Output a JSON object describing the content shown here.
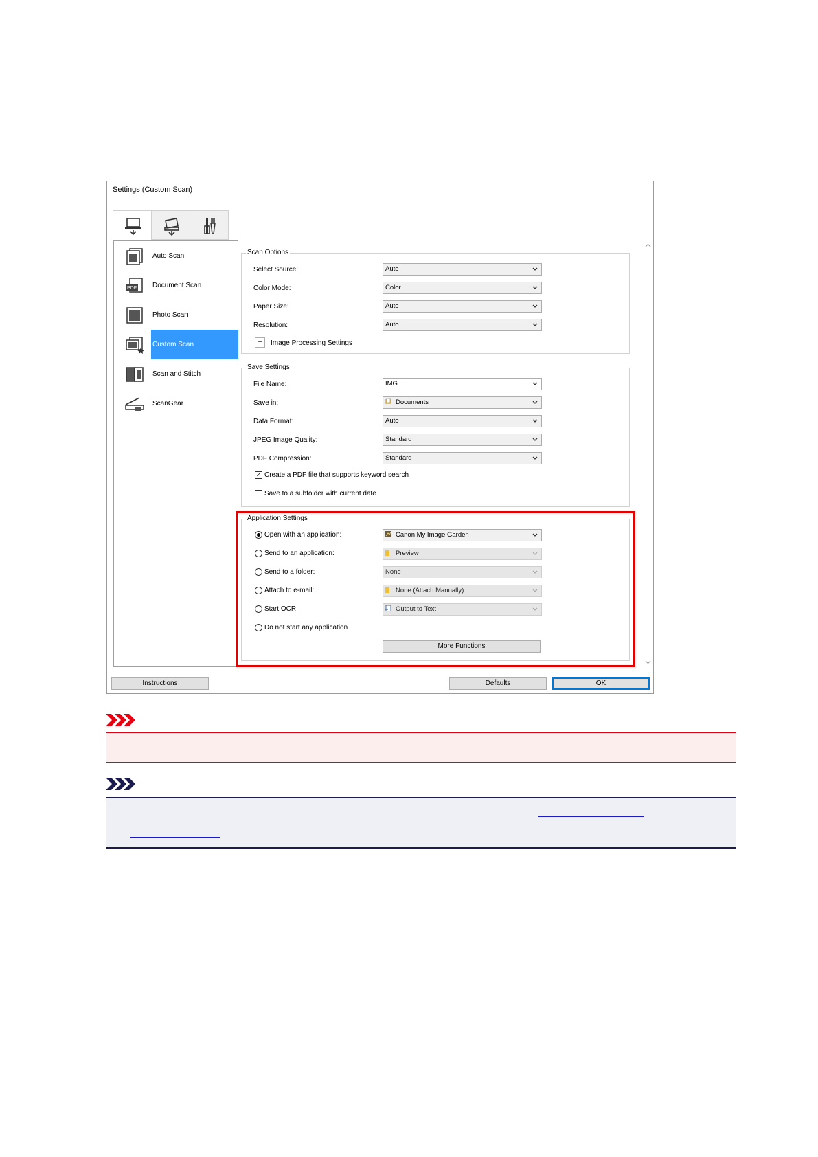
{
  "window": {
    "title": "Settings (Custom Scan)",
    "tabs": [
      {
        "icon": "scan-from-computer-icon",
        "active": true
      },
      {
        "icon": "scan-from-operation-panel-icon",
        "active": false
      },
      {
        "icon": "general-settings-icon",
        "active": false
      }
    ]
  },
  "sidebar": {
    "items": [
      {
        "label": "Auto Scan",
        "icon": "auto-scan-icon"
      },
      {
        "label": "Document Scan",
        "icon": "document-scan-icon"
      },
      {
        "label": "Photo Scan",
        "icon": "photo-scan-icon"
      },
      {
        "label": "Custom Scan",
        "icon": "custom-scan-icon",
        "selected": true
      },
      {
        "label": "Scan and Stitch",
        "icon": "scan-and-stitch-icon"
      },
      {
        "label": "ScanGear",
        "icon": "scangear-icon"
      }
    ]
  },
  "scan_options": {
    "title": "Scan Options",
    "rows": [
      {
        "label": "Select Source:",
        "value": "Auto"
      },
      {
        "label": "Color Mode:",
        "value": "Color"
      },
      {
        "label": "Paper Size:",
        "value": "Auto"
      },
      {
        "label": "Resolution:",
        "value": "Auto"
      }
    ],
    "image_processing": {
      "expander": "+",
      "label": "Image Processing Settings"
    }
  },
  "save_settings": {
    "title": "Save Settings",
    "rows": [
      {
        "label": "File Name:",
        "value": "IMG"
      },
      {
        "label": "Save in:",
        "value": "Documents"
      },
      {
        "label": "Data Format:",
        "value": "Auto"
      },
      {
        "label": "JPEG Image Quality:",
        "value": "Standard"
      },
      {
        "label": "PDF Compression:",
        "value": "Standard"
      }
    ],
    "checkboxes": [
      {
        "label": "Create a PDF file that supports keyword search",
        "checked": true,
        "mark": "✓"
      },
      {
        "label": "Save to a subfolder with current date",
        "checked": false
      }
    ]
  },
  "application_settings": {
    "title": "Application Settings",
    "rows": [
      {
        "label": "Open with an application:",
        "value": "Canon My Image Garden",
        "selected": true,
        "enabled": true
      },
      {
        "label": "Send to an application:",
        "value": "Preview",
        "enabled": false
      },
      {
        "label": "Send to a folder:",
        "value": "None",
        "enabled": false
      },
      {
        "label": "Attach to e-mail:",
        "value": "None (Attach Manually)",
        "enabled": false
      },
      {
        "label": "Start OCR:",
        "value": "Output to Text",
        "enabled": false
      },
      {
        "label": "Do not start any application"
      }
    ],
    "more_functions": "More Functions"
  },
  "footer": {
    "instructions": "Instructions",
    "defaults": "Defaults",
    "ok": "OK"
  },
  "colors": {
    "selection": "#3399ff",
    "highlight": "#e50000",
    "important_bg": "#fdeeee",
    "note_bg": "#eef0f6",
    "note_line": "#1b1b4d",
    "link": "#1a1acc"
  },
  "notes": {
    "important_icon": "important-arrows-icon",
    "note_icon": "note-arrows-icon"
  }
}
